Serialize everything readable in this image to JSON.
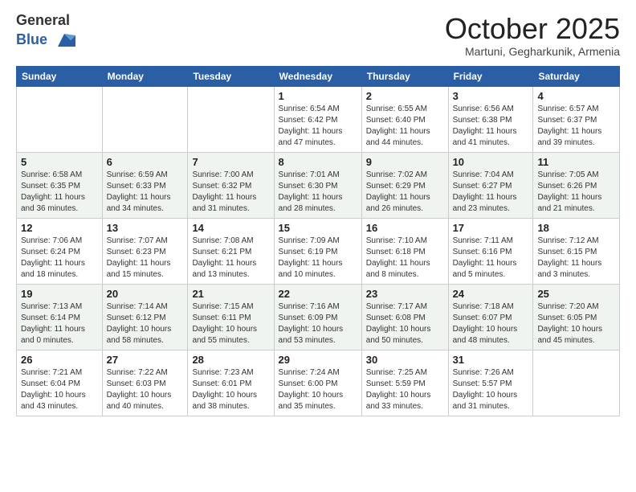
{
  "header": {
    "logo_line1": "General",
    "logo_line2": "Blue",
    "month": "October 2025",
    "location": "Martuni, Gegharkunik, Armenia"
  },
  "weekdays": [
    "Sunday",
    "Monday",
    "Tuesday",
    "Wednesday",
    "Thursday",
    "Friday",
    "Saturday"
  ],
  "weeks": [
    [
      {
        "day": "",
        "info": ""
      },
      {
        "day": "",
        "info": ""
      },
      {
        "day": "",
        "info": ""
      },
      {
        "day": "1",
        "info": "Sunrise: 6:54 AM\nSunset: 6:42 PM\nDaylight: 11 hours and 47 minutes."
      },
      {
        "day": "2",
        "info": "Sunrise: 6:55 AM\nSunset: 6:40 PM\nDaylight: 11 hours and 44 minutes."
      },
      {
        "day": "3",
        "info": "Sunrise: 6:56 AM\nSunset: 6:38 PM\nDaylight: 11 hours and 41 minutes."
      },
      {
        "day": "4",
        "info": "Sunrise: 6:57 AM\nSunset: 6:37 PM\nDaylight: 11 hours and 39 minutes."
      }
    ],
    [
      {
        "day": "5",
        "info": "Sunrise: 6:58 AM\nSunset: 6:35 PM\nDaylight: 11 hours and 36 minutes."
      },
      {
        "day": "6",
        "info": "Sunrise: 6:59 AM\nSunset: 6:33 PM\nDaylight: 11 hours and 34 minutes."
      },
      {
        "day": "7",
        "info": "Sunrise: 7:00 AM\nSunset: 6:32 PM\nDaylight: 11 hours and 31 minutes."
      },
      {
        "day": "8",
        "info": "Sunrise: 7:01 AM\nSunset: 6:30 PM\nDaylight: 11 hours and 28 minutes."
      },
      {
        "day": "9",
        "info": "Sunrise: 7:02 AM\nSunset: 6:29 PM\nDaylight: 11 hours and 26 minutes."
      },
      {
        "day": "10",
        "info": "Sunrise: 7:04 AM\nSunset: 6:27 PM\nDaylight: 11 hours and 23 minutes."
      },
      {
        "day": "11",
        "info": "Sunrise: 7:05 AM\nSunset: 6:26 PM\nDaylight: 11 hours and 21 minutes."
      }
    ],
    [
      {
        "day": "12",
        "info": "Sunrise: 7:06 AM\nSunset: 6:24 PM\nDaylight: 11 hours and 18 minutes."
      },
      {
        "day": "13",
        "info": "Sunrise: 7:07 AM\nSunset: 6:23 PM\nDaylight: 11 hours and 15 minutes."
      },
      {
        "day": "14",
        "info": "Sunrise: 7:08 AM\nSunset: 6:21 PM\nDaylight: 11 hours and 13 minutes."
      },
      {
        "day": "15",
        "info": "Sunrise: 7:09 AM\nSunset: 6:19 PM\nDaylight: 11 hours and 10 minutes."
      },
      {
        "day": "16",
        "info": "Sunrise: 7:10 AM\nSunset: 6:18 PM\nDaylight: 11 hours and 8 minutes."
      },
      {
        "day": "17",
        "info": "Sunrise: 7:11 AM\nSunset: 6:16 PM\nDaylight: 11 hours and 5 minutes."
      },
      {
        "day": "18",
        "info": "Sunrise: 7:12 AM\nSunset: 6:15 PM\nDaylight: 11 hours and 3 minutes."
      }
    ],
    [
      {
        "day": "19",
        "info": "Sunrise: 7:13 AM\nSunset: 6:14 PM\nDaylight: 11 hours and 0 minutes."
      },
      {
        "day": "20",
        "info": "Sunrise: 7:14 AM\nSunset: 6:12 PM\nDaylight: 10 hours and 58 minutes."
      },
      {
        "day": "21",
        "info": "Sunrise: 7:15 AM\nSunset: 6:11 PM\nDaylight: 10 hours and 55 minutes."
      },
      {
        "day": "22",
        "info": "Sunrise: 7:16 AM\nSunset: 6:09 PM\nDaylight: 10 hours and 53 minutes."
      },
      {
        "day": "23",
        "info": "Sunrise: 7:17 AM\nSunset: 6:08 PM\nDaylight: 10 hours and 50 minutes."
      },
      {
        "day": "24",
        "info": "Sunrise: 7:18 AM\nSunset: 6:07 PM\nDaylight: 10 hours and 48 minutes."
      },
      {
        "day": "25",
        "info": "Sunrise: 7:20 AM\nSunset: 6:05 PM\nDaylight: 10 hours and 45 minutes."
      }
    ],
    [
      {
        "day": "26",
        "info": "Sunrise: 7:21 AM\nSunset: 6:04 PM\nDaylight: 10 hours and 43 minutes."
      },
      {
        "day": "27",
        "info": "Sunrise: 7:22 AM\nSunset: 6:03 PM\nDaylight: 10 hours and 40 minutes."
      },
      {
        "day": "28",
        "info": "Sunrise: 7:23 AM\nSunset: 6:01 PM\nDaylight: 10 hours and 38 minutes."
      },
      {
        "day": "29",
        "info": "Sunrise: 7:24 AM\nSunset: 6:00 PM\nDaylight: 10 hours and 35 minutes."
      },
      {
        "day": "30",
        "info": "Sunrise: 7:25 AM\nSunset: 5:59 PM\nDaylight: 10 hours and 33 minutes."
      },
      {
        "day": "31",
        "info": "Sunrise: 7:26 AM\nSunset: 5:57 PM\nDaylight: 10 hours and 31 minutes."
      },
      {
        "day": "",
        "info": ""
      }
    ]
  ]
}
